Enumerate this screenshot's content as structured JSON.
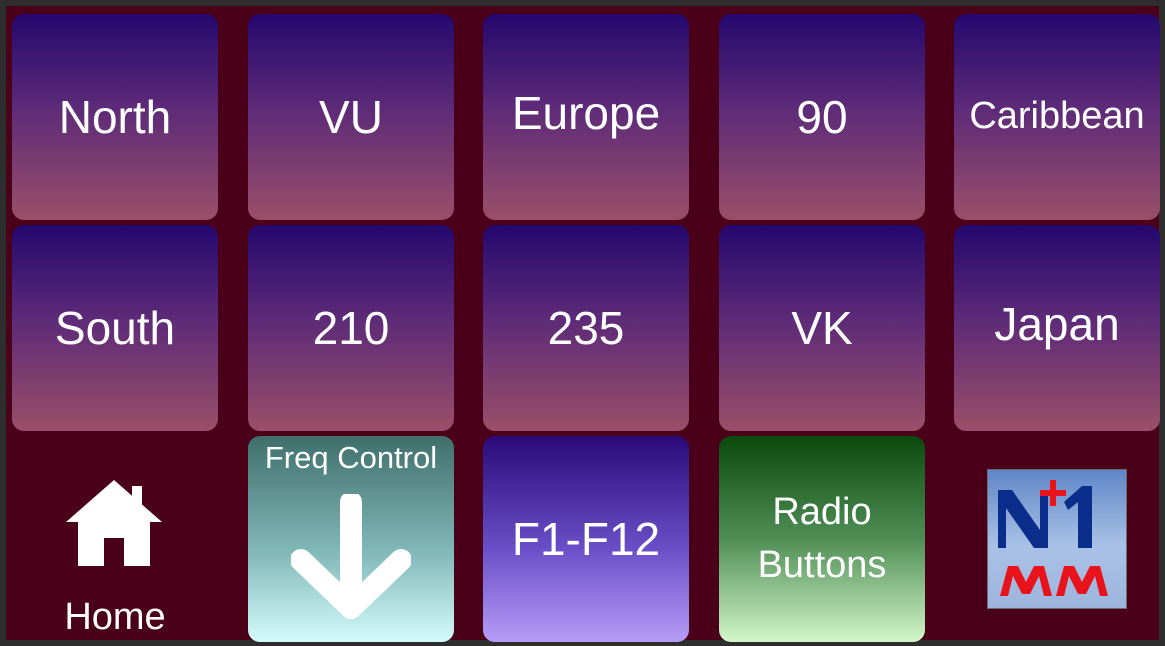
{
  "row1": [
    "North",
    "VU",
    "Europe",
    "90",
    "Caribbean"
  ],
  "row2": [
    "South",
    "210",
    "235",
    "VK",
    "Japan"
  ],
  "bottom": {
    "home_label": "Home",
    "freq_control_label": "Freq Control",
    "fkeys_label": "F1-F12",
    "radio_buttons_line1": "Radio",
    "radio_buttons_line2": "Buttons",
    "logo_text_top": "N+1",
    "logo_text_bottom": "MM"
  },
  "colors": {
    "background": "#4a0019",
    "tile_top": "#24086e",
    "tile_bottom": "#9a4f68",
    "logo_red": "#e8131b",
    "logo_blue": "#0b2d8c"
  }
}
